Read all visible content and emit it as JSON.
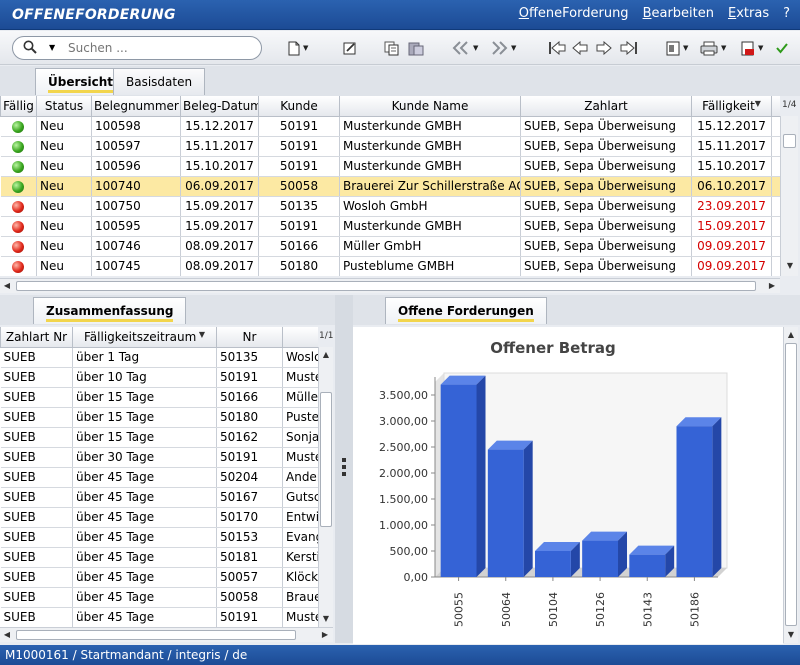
{
  "app": {
    "title": "OFFENEFORDERUNG",
    "menu": [
      "OffeneForderung",
      "Bearbeiten",
      "Extras",
      "?"
    ]
  },
  "toolbar": {
    "search_placeholder": "Suchen ...",
    "icons": [
      "new-doc-icon",
      "edit-icon",
      "copy-icon",
      "paste-icon",
      "double-left-icon",
      "double-right-icon",
      "first-icon",
      "prev-icon",
      "next-icon",
      "last-icon",
      "export-icon",
      "print-icon",
      "pdf-icon",
      "check-icon"
    ]
  },
  "top_tabs": [
    "Übersicht",
    "Basisdaten"
  ],
  "top_grid": {
    "pager": "1/4",
    "columns": [
      "Fällig",
      "Status",
      "Belegnummer",
      "Beleg-Datum",
      "Kunde",
      "Kunde Name",
      "Zahlart",
      "Fälligkeit"
    ],
    "rows": [
      {
        "dot": "green",
        "status": "Neu",
        "beleg": "100598",
        "datum": "15.12.2017",
        "kunde": "50191",
        "name": "Musterkunde GMBH",
        "zahlart": "SUEB, Sepa Überweisung",
        "faellig": "15.12.2017",
        "overdue": false
      },
      {
        "dot": "green",
        "status": "Neu",
        "beleg": "100597",
        "datum": "15.11.2017",
        "kunde": "50191",
        "name": "Musterkunde GMBH",
        "zahlart": "SUEB, Sepa Überweisung",
        "faellig": "15.11.2017",
        "overdue": false
      },
      {
        "dot": "green",
        "status": "Neu",
        "beleg": "100596",
        "datum": "15.10.2017",
        "kunde": "50191",
        "name": "Musterkunde GMBH",
        "zahlart": "SUEB, Sepa Überweisung",
        "faellig": "15.10.2017",
        "overdue": false
      },
      {
        "dot": "green",
        "status": "Neu",
        "beleg": "100740",
        "datum": "06.09.2017",
        "kunde": "50058",
        "name": "Brauerei Zur Schillerstraße AG",
        "zahlart": "SUEB, Sepa Überweisung",
        "faellig": "06.10.2017",
        "overdue": false,
        "selected": true
      },
      {
        "dot": "red",
        "status": "Neu",
        "beleg": "100750",
        "datum": "15.09.2017",
        "kunde": "50135",
        "name": "Wosloh GmbH",
        "zahlart": "SUEB, Sepa Überweisung",
        "faellig": "23.09.2017",
        "overdue": true
      },
      {
        "dot": "red",
        "status": "Neu",
        "beleg": "100595",
        "datum": "15.09.2017",
        "kunde": "50191",
        "name": "Musterkunde GMBH",
        "zahlart": "SUEB, Sepa Überweisung",
        "faellig": "15.09.2017",
        "overdue": true
      },
      {
        "dot": "red",
        "status": "Neu",
        "beleg": "100746",
        "datum": "08.09.2017",
        "kunde": "50166",
        "name": "Müller GmbH",
        "zahlart": "SUEB, Sepa Überweisung",
        "faellig": "09.09.2017",
        "overdue": true
      },
      {
        "dot": "red",
        "status": "Neu",
        "beleg": "100745",
        "datum": "08.09.2017",
        "kunde": "50180",
        "name": "Pusteblume GMBH",
        "zahlart": "SUEB, Sepa Überweisung",
        "faellig": "09.09.2017",
        "overdue": true
      }
    ]
  },
  "left_panel": {
    "tab": "Zusammenfassung",
    "pager": "1/1",
    "columns": [
      "Zahlart Nr",
      "Fälligkeitszeitraum",
      "Nr",
      ""
    ],
    "rows": [
      [
        "SUEB",
        "über 1 Tag",
        "50135",
        "Wosloh"
      ],
      [
        "SUEB",
        "über 10 Tag",
        "50191",
        "Musterkunde"
      ],
      [
        "SUEB",
        "über 15 Tage",
        "50166",
        "Müller"
      ],
      [
        "SUEB",
        "über 15 Tage",
        "50180",
        "Pusteblume"
      ],
      [
        "SUEB",
        "über 15 Tage",
        "50162",
        "Sonja"
      ],
      [
        "SUEB",
        "über 30 Tage",
        "50191",
        "Musterkunde"
      ],
      [
        "SUEB",
        "über 45 Tage",
        "50204",
        "Anders"
      ],
      [
        "SUEB",
        "über 45 Tage",
        "50167",
        "Gutschein"
      ],
      [
        "SUEB",
        "über 45 Tage",
        "50170",
        "Entwicklung"
      ],
      [
        "SUEB",
        "über 45 Tage",
        "50153",
        "Evangelisch"
      ],
      [
        "SUEB",
        "über 45 Tage",
        "50181",
        "Kerstin"
      ],
      [
        "SUEB",
        "über 45 Tage",
        "50057",
        "Klöckner"
      ],
      [
        "SUEB",
        "über 45 Tage",
        "50058",
        "Brauerei"
      ],
      [
        "SUEB",
        "über 45 Tage",
        "50191",
        "Musterkunde"
      ]
    ]
  },
  "right_panel": {
    "tab": "Offene Forderungen"
  },
  "chart_data": {
    "type": "bar",
    "title": "Offener Betrag",
    "categories": [
      "50055",
      "50064",
      "50104",
      "50126",
      "50143",
      "50186"
    ],
    "values": [
      3700,
      2450,
      500,
      700,
      430,
      2900
    ],
    "ylim": [
      0,
      3750
    ],
    "yticks": [
      0,
      500,
      1000,
      1500,
      2000,
      2500,
      3000,
      3500
    ],
    "ytick_labels": [
      "0,00",
      "500,00",
      "1.000,00",
      "1.500,00",
      "2.000,00",
      "2.500,00",
      "3.000,00",
      "3.500,00"
    ],
    "bar_color": "#3563d6",
    "grid": false
  },
  "status": {
    "text": "M1000161 / Startmandant / integris / de"
  }
}
